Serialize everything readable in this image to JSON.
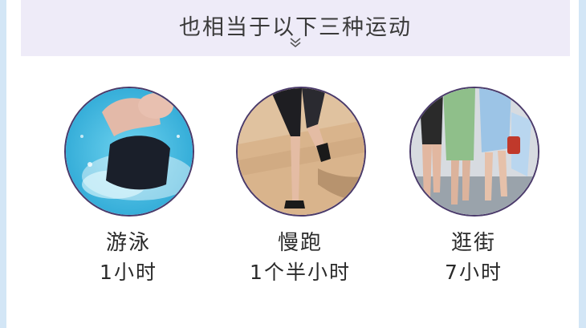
{
  "header": {
    "title": "也相当于以下三种运动",
    "chevron_icon": "double-chevron-down-icon"
  },
  "activities": [
    {
      "name": "游泳",
      "duration": "1小时",
      "image": "swimming-photo"
    },
    {
      "name": "慢跑",
      "duration": "1个半小时",
      "image": "jogging-photo"
    },
    {
      "name": "逛街",
      "duration": "7小时",
      "image": "shopping-walk-photo"
    }
  ],
  "colors": {
    "header_band": "#eeebf8",
    "side_edges": "#d3e6f6",
    "circle_border": "#4a3a6a"
  }
}
